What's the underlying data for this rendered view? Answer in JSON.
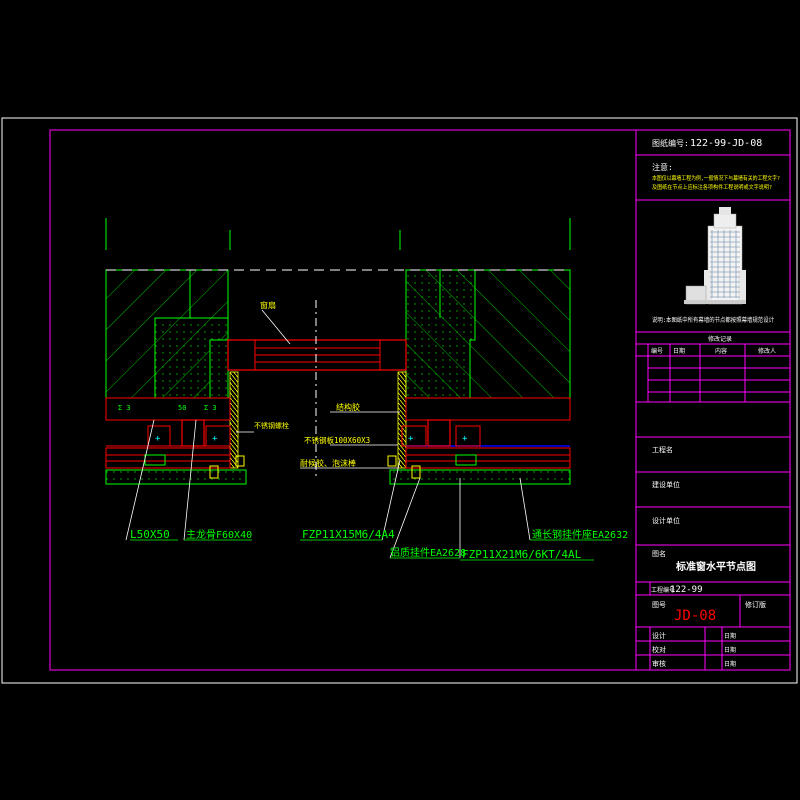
{
  "drawing_no": {
    "label": "图纸编号:",
    "value": "122-99-JD-08"
  },
  "notes": {
    "title": "注意:",
    "line1": "本图仅以幕墙工程为例,一般情况下与幕墙有关的工程文字?",
    "line2": "及图纸在节点上应标注各项构件工程说明或文字说明?"
  },
  "building_caption": "说明:本图纸中所有幕墙的节点都按照幕墙规范设计",
  "revision": {
    "title": "修改记录",
    "headers": [
      "编号",
      "日期",
      "内容",
      "修改人"
    ]
  },
  "fields": {
    "project": "工程名",
    "client": "建设单位",
    "design": "设计单位"
  },
  "title_block": {
    "name_label": "图名",
    "name_value": "标准窗水平节点图",
    "proj_no_label": "工程编号",
    "proj_no_value": "122-99",
    "drawing_label": "图号",
    "drawing_value": "JD-08",
    "version_label": "修订版",
    "rows": [
      {
        "label": "设计",
        "date": "日期"
      },
      {
        "label": "校对",
        "date": "日期"
      },
      {
        "label": "审核",
        "date": "日期"
      }
    ]
  },
  "annotations": {
    "window": "窗扇",
    "glue": "结构胶",
    "ss_bolt": "不锈钢螺栓",
    "ss_plate": "不锈钢板100X60X3",
    "sealant": "耐候胶、泡沫棒",
    "l_angle": "L50X50",
    "main_beam": "主龙骨F60X40",
    "fzp1": "FZP11X15M6/4A4",
    "alu_part": "铝质挂件EA2628",
    "fzp2": "FZP11X21M6/6KT/4AL",
    "conn_part": "通长钢挂件座EA2632"
  },
  "colors": {
    "frame": "#ffffff",
    "red": "#ff0000",
    "green": "#00ff00",
    "yellow": "#ffff00",
    "cyan": "#00ffff",
    "magenta": "#ff00ff",
    "blue": "#0000ff"
  }
}
